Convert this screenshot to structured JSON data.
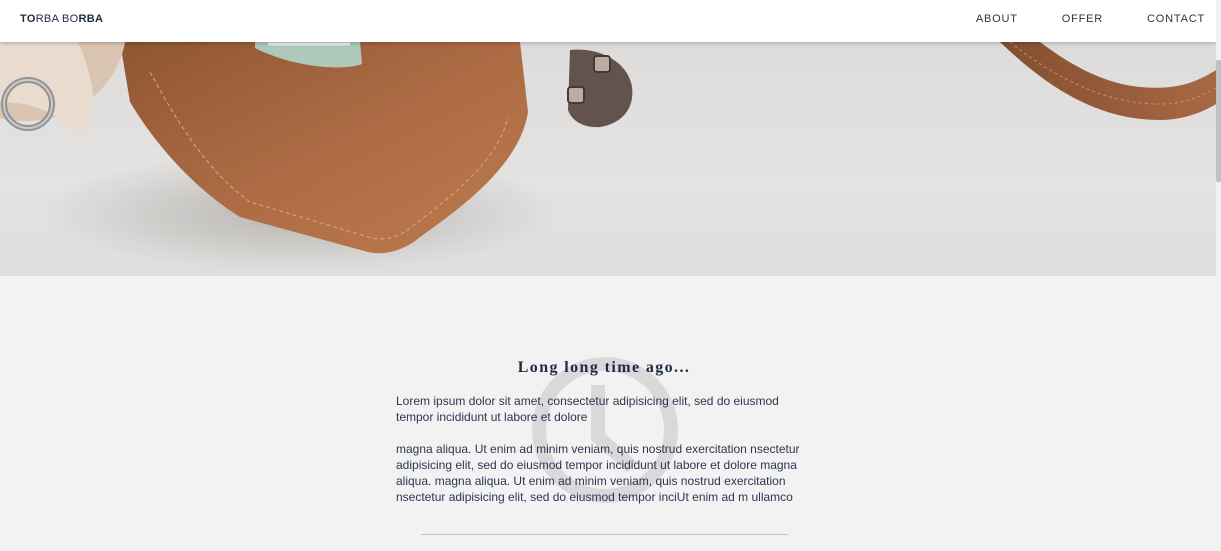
{
  "header": {
    "logo_part1": "TO",
    "logo_part2": "RBA BO",
    "logo_part3": "RBA",
    "nav": {
      "about": "ABOUT",
      "offer": "OFFER",
      "contact": "CONTACT"
    }
  },
  "article": {
    "title": "Long long time ago...",
    "paragraph1": "Lorem ipsum dolor sit amet, consectetur adipisicing elit, sed do eiusmod tempor incididunt ut labore et dolore",
    "paragraph2": "magna aliqua. Ut enim ad minim veniam, quis nostrud exercitation nsectetur adipisicing elit, sed do eiusmod tempor incididunt ut labore et dolore magna aliqua. magna aliqua. Ut enim ad minim veniam, quis nostrud exercitation nsectetur adipisicing elit, sed do eiusmod tempor inciUt enim ad m ullamco"
  },
  "colors": {
    "text_primary": "#1f2a44",
    "page_background": "#f2f2f2",
    "leather": "#a8643a"
  },
  "icons": {
    "clock_watermark": "clock-icon"
  }
}
